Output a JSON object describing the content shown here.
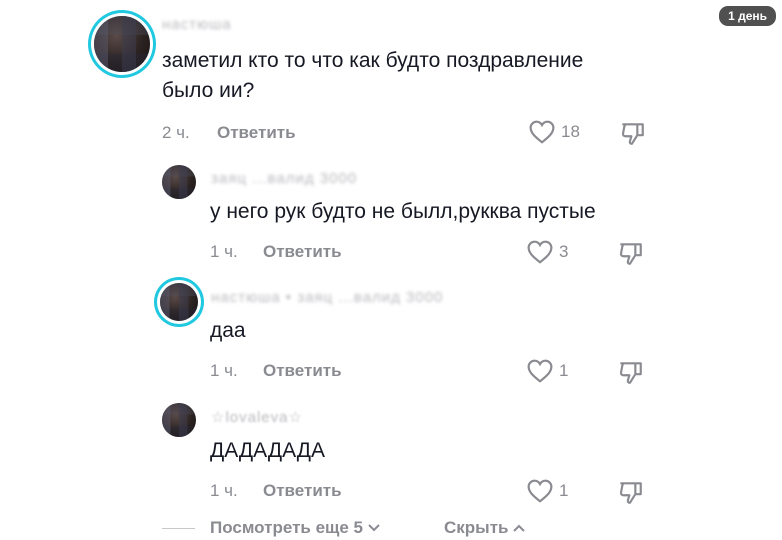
{
  "badge": "1 день",
  "comments": [
    {
      "username": "настюша",
      "text_lines": [
        "заметил кто то что как будто поздравление",
        "было ии?"
      ],
      "time": "2 ч.",
      "reply_label": "Ответить",
      "likes": "18"
    },
    {
      "username": "заяц ...валид 3000",
      "text_lines": [
        "у него рук будто не былл,рукква пустые"
      ],
      "time": "1 ч.",
      "reply_label": "Ответить",
      "likes": "3"
    },
    {
      "username": "настюша • заяц ...валид 3000",
      "text_lines": [
        "даа"
      ],
      "time": "1 ч.",
      "reply_label": "Ответить",
      "likes": "1"
    },
    {
      "username": "☆lovaleva☆",
      "text_lines": [
        "ДАДАДАДА"
      ],
      "time": "1 ч.",
      "reply_label": "Ответить",
      "likes": "1"
    }
  ],
  "footer": {
    "more_label": "Посмотреть еще 5",
    "hide_label": "Скрыть"
  },
  "icons": {
    "like": "heart-outline-icon",
    "dislike": "thumbs-down-icon"
  },
  "colors": {
    "ring": "#20c8e0",
    "muted": "#8a8b91",
    "text": "#161823"
  }
}
